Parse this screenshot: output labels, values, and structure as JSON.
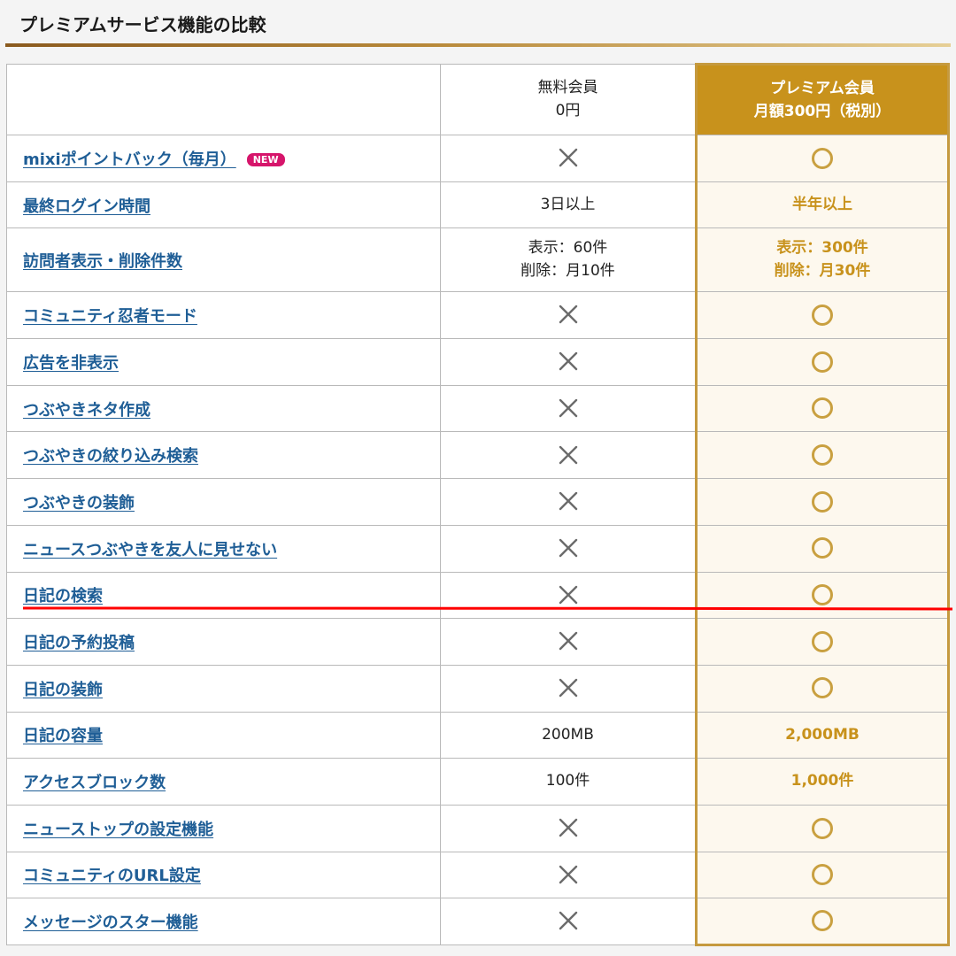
{
  "page": {
    "title": "プレミアムサービス機能の比較"
  },
  "columns": {
    "free": {
      "name": "無料会員",
      "price": "0円"
    },
    "premium": {
      "name": "プレミアム会員",
      "price": "月額300円（税別）"
    }
  },
  "badge_new": "NEW",
  "rows": [
    {
      "feature": "mixiポイントバック（毎月）",
      "badge": true,
      "free": null,
      "free2": null,
      "premium": null,
      "premium2": null
    },
    {
      "feature": "最終ログイン時間",
      "free": "3日以上",
      "free2": null,
      "premium": "半年以上",
      "premium2": null
    },
    {
      "feature": "訪問者表示・削除件数",
      "free": "表示：60件",
      "free2": "削除：月10件",
      "premium": "表示：300件",
      "premium2": "削除：月30件"
    },
    {
      "feature": "コミュニティ忍者モード",
      "free": null,
      "free2": null,
      "premium": null,
      "premium2": null
    },
    {
      "feature": "広告を非表示",
      "free": null,
      "free2": null,
      "premium": null,
      "premium2": null
    },
    {
      "feature": "つぶやきネタ作成",
      "free": null,
      "free2": null,
      "premium": null,
      "premium2": null
    },
    {
      "feature": "つぶやきの絞り込み検索",
      "free": null,
      "free2": null,
      "premium": null,
      "premium2": null
    },
    {
      "feature": "つぶやきの装飾",
      "free": null,
      "free2": null,
      "premium": null,
      "premium2": null
    },
    {
      "feature": "ニュースつぶやきを友人に見せない",
      "free": null,
      "free2": null,
      "premium": null,
      "premium2": null
    },
    {
      "feature": "日記の検索",
      "free": null,
      "free2": null,
      "premium": null,
      "premium2": null
    },
    {
      "feature": "日記の予約投稿",
      "free": null,
      "free2": null,
      "premium": null,
      "premium2": null
    },
    {
      "feature": "日記の装飾",
      "free": null,
      "free2": null,
      "premium": null,
      "premium2": null
    },
    {
      "feature": "日記の容量",
      "free": "200MB",
      "free2": null,
      "premium": "2,000MB",
      "premium2": null
    },
    {
      "feature": "アクセスブロック数",
      "free": "100件",
      "free2": null,
      "premium": "1,000件",
      "premium2": null
    },
    {
      "feature": "ニューストップの設定機能",
      "free": null,
      "free2": null,
      "premium": null,
      "premium2": null
    },
    {
      "feature": "コミュニティのURL設定",
      "free": null,
      "free2": null,
      "premium": null,
      "premium2": null
    },
    {
      "feature": "メッセージのスター機能",
      "free": null,
      "free2": null,
      "premium": null,
      "premium2": null
    }
  ],
  "icons": {
    "unavailable": "cross-icon",
    "available": "circle-icon"
  },
  "colors": {
    "premium_accent": "#c8921c",
    "link": "#1f5e96",
    "badge": "#d6156b",
    "cross": "#6b6b6b",
    "circle": "#c9a040",
    "annotation": "#ff0000"
  }
}
